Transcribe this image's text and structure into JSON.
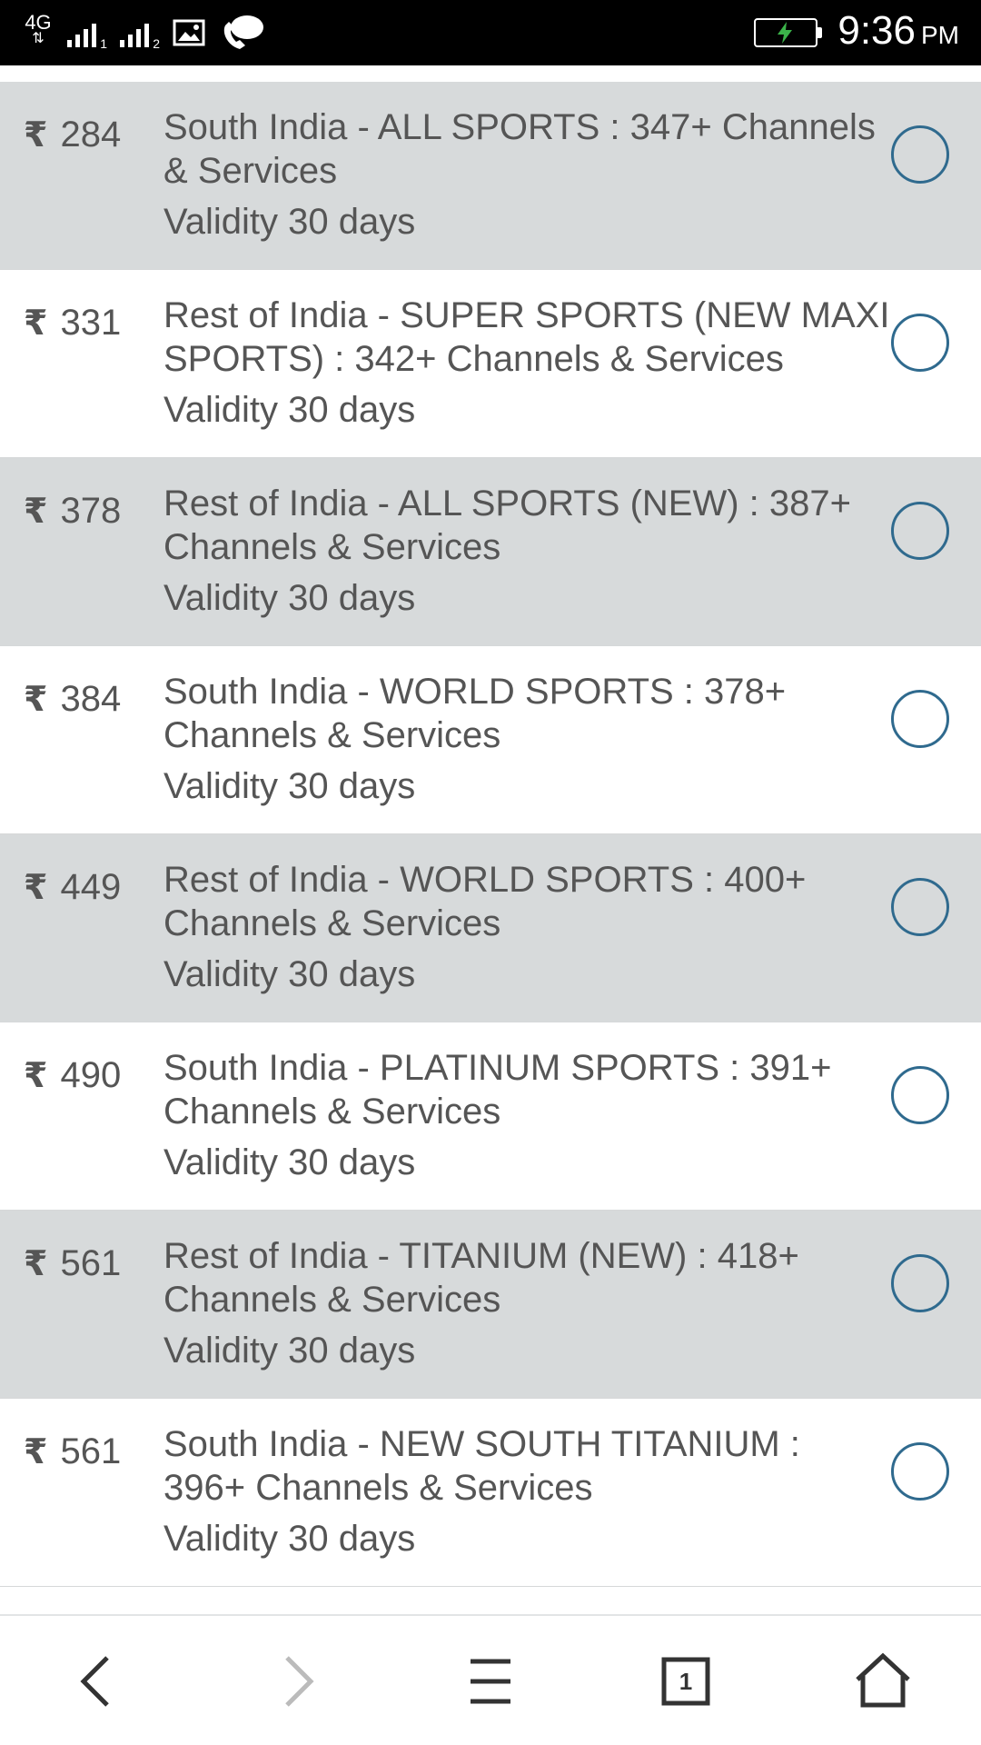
{
  "status_bar": {
    "network": "4G",
    "sim1_label": "1",
    "sim2_label": "2",
    "time": "9:36",
    "ampm": "PM"
  },
  "currency_symbol": "₹",
  "plans": [
    {
      "price": "284",
      "title": "South India - ALL SPORTS : 347+ Channels & Services",
      "validity": "Validity 30 days"
    },
    {
      "price": "331",
      "title": "Rest of India - SUPER SPORTS (NEW MAXI SPORTS) : 342+ Channels & Services",
      "validity": "Validity 30 days"
    },
    {
      "price": "378",
      "title": "Rest of India - ALL SPORTS (NEW) : 387+ Channels & Services",
      "validity": "Validity 30 days"
    },
    {
      "price": "384",
      "title": "South India - WORLD SPORTS : 378+ Channels & Services",
      "validity": "Validity 30 days"
    },
    {
      "price": "449",
      "title": "Rest of India - WORLD SPORTS : 400+ Channels & Services",
      "validity": "Validity 30 days"
    },
    {
      "price": "490",
      "title": "South India - PLATINUM SPORTS : 391+ Channels & Services",
      "validity": "Validity 30 days"
    },
    {
      "price": "561",
      "title": "Rest of India - TITANIUM (NEW) : 418+ Channels & Services",
      "validity": "Validity 30 days"
    },
    {
      "price": "561",
      "title": "South India - NEW SOUTH TITANIUM : 396+ Channels & Services",
      "validity": "Validity 30 days"
    }
  ],
  "bottom_nav": {
    "tab_count": "1",
    "icons": [
      "back-icon",
      "forward-icon",
      "menu-icon",
      "tabs-icon",
      "home-icon"
    ]
  },
  "colors": {
    "shaded_row": "#d7dadb",
    "text": "#555555",
    "radio_border": "#2f6a8e"
  }
}
